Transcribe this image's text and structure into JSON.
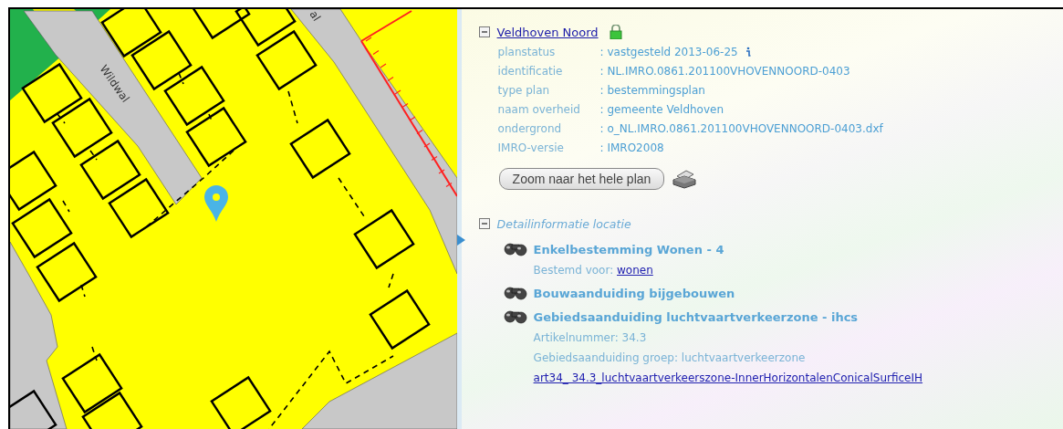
{
  "map": {
    "street_labels": [
      "Wildwal",
      "al"
    ]
  },
  "plan": {
    "title": "Veldhoven Noord",
    "expanded": true,
    "properties": [
      {
        "label": "planstatus",
        "value": ": vastgesteld 2013-06-25",
        "info": true
      },
      {
        "label": "identificatie",
        "value": ": NL.IMRO.0861.201100VHOVENNOORD-0403",
        "info": false
      },
      {
        "label": "type plan",
        "value": ": bestemmingsplan",
        "info": false
      },
      {
        "label": "naam overheid",
        "value": ": gemeente Veldhoven",
        "info": false
      },
      {
        "label": "ondergrond",
        "value": ": o_NL.IMRO.0861.201100VHOVENNOORD-0403.dxf",
        "info": false
      },
      {
        "label": "IMRO-versie",
        "value": ": IMRO2008",
        "info": false
      }
    ],
    "zoom_button": "Zoom naar het hele plan"
  },
  "detail": {
    "title": "Detailinformatie locatie",
    "expanded": true,
    "items": [
      {
        "title": "Enkelbestemming Wonen - 4",
        "lines": [
          {
            "kind": "labeled_link",
            "label": "Bestemd voor:",
            "link": "wonen"
          }
        ]
      },
      {
        "title": "Bouwaanduiding bijgebouwen"
      },
      {
        "title": "Gebiedsaanduiding luchtvaartverkeerzone - ihcs",
        "lines": [
          {
            "kind": "text",
            "text": "Artikelnummer: 34.3"
          },
          {
            "kind": "text",
            "text": "Gebiedsaanduiding groep: luchtvaartverkeerzone"
          },
          {
            "kind": "link",
            "link": "art34_ 34.3_luchtvaartverkeerszone-InnerHorizontalenConicalSurficeIH"
          }
        ]
      }
    ]
  }
}
